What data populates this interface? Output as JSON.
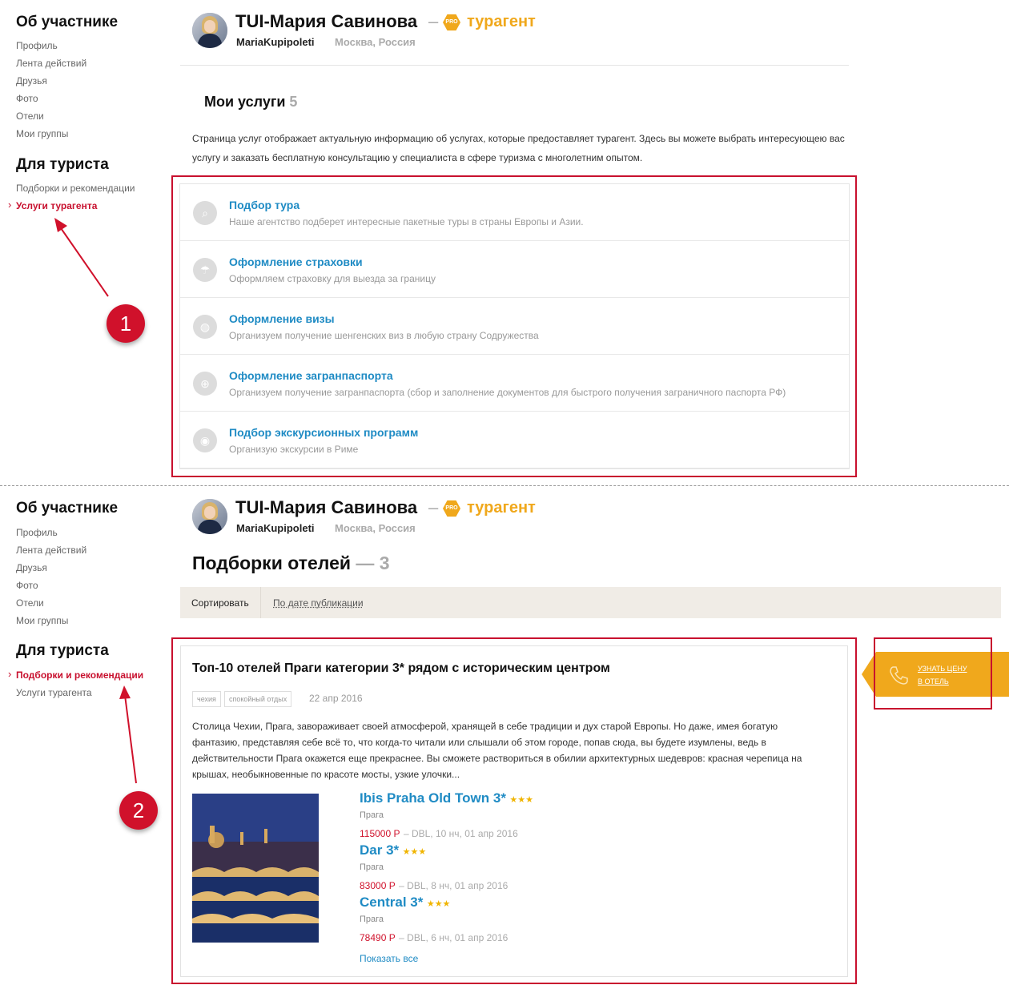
{
  "sidebar": {
    "about_heading": "Об участнике",
    "about_items": [
      "Профиль",
      "Лента действий",
      "Друзья",
      "Фото",
      "Отели",
      "Мои группы"
    ],
    "tourist_heading": "Для туриста",
    "tourist_items": [
      "Подборки и рекомендации",
      "Услуги турагента"
    ]
  },
  "profile": {
    "name": "TUI-Мария Савинова",
    "dash": "–",
    "pro_badge": "PRO",
    "role": "турагент",
    "login": "MariaKupipoleti",
    "city": "Москва, Россия"
  },
  "services": {
    "heading": "Мои услуги",
    "count": "5",
    "description_line1": "Страница услуг отображает актуальную информацию об услугах, которые предоставляет турагент. Здесь вы можете выбрать интересующею вас",
    "description_line2": "услугу и заказать бесплатную консультацию у специалиста в сфере туризма с многолетним опытом.",
    "items": [
      {
        "title": "Подбор тура",
        "desc": "Наше агентство подберет интересные пакетные туры в страны Европы и Азии.",
        "icon": "search-icon"
      },
      {
        "title": "Оформление страховки",
        "desc": "Оформляем страховку для выезда за границу",
        "icon": "umbrella-icon"
      },
      {
        "title": "Оформление визы",
        "desc": "Организуем получение шенгенских виз в любую страну Содружества",
        "icon": "globe-icon"
      },
      {
        "title": "Оформление загранпаспорта",
        "desc": "Организуем получение загранпаспорта (сбор и заполнение документов для быстрого получения заграничного паспорта РФ)",
        "icon": "passport-icon"
      },
      {
        "title": "Подбор экскурсионных программ",
        "desc": "Организую экскурсии в Риме",
        "icon": "map-pin-icon"
      }
    ]
  },
  "markers": {
    "first": "1",
    "second": "2"
  },
  "collections": {
    "heading": "Подборки отелей",
    "dash": "—",
    "count": "3",
    "sort_label": "Сортировать",
    "sort_option": "По дате публикации",
    "card": {
      "title": "Топ-10 отелей Праги категории 3* рядом с историческим центром",
      "tags": [
        "чехия",
        "спокойный отдых"
      ],
      "date": "22 апр 2016",
      "text": [
        "Столица Чехии, Прага, завораживает своей атмосферой, хранящей в себе традиции и дух старой Европы. Но даже, имея богатую",
        "фантазию, представляя себе всё то, что когда-то читали или слышали об этом городе, попав сюда, вы будете изумлены, ведь в",
        "действительности Прага окажется еще прекраснее. Вы сможете раствориться в обилии архитектурных шедевров: красная черепица на",
        "крышах, необыкновенные по красоте мосты, узкие улочки..."
      ],
      "hotels": [
        {
          "name": "Ibis Praha Old Town 3*",
          "stars": "★★★",
          "city": "Прага",
          "price": "115000 Р",
          "info": "– DBL, 10 нч, 01 апр 2016"
        },
        {
          "name": "Dar 3*",
          "stars": "★★★",
          "city": "Прага",
          "price": "83000 Р",
          "info": "– DBL, 8 нч, 01 апр 2016"
        },
        {
          "name": "Central 3*",
          "stars": "★★★",
          "city": "Прага",
          "price": "78490 Р",
          "info": "– DBL, 6 нч, 01 апр 2016"
        }
      ],
      "show_all": "Показать все"
    },
    "cta": {
      "line1": "УЗНАТЬ ЦЕНУ",
      "line2": "В ОТЕЛЬ"
    }
  },
  "colors": {
    "accent_red": "#c8102e",
    "link_blue": "#1f8bc4",
    "pro_orange": "#f0a81c"
  }
}
